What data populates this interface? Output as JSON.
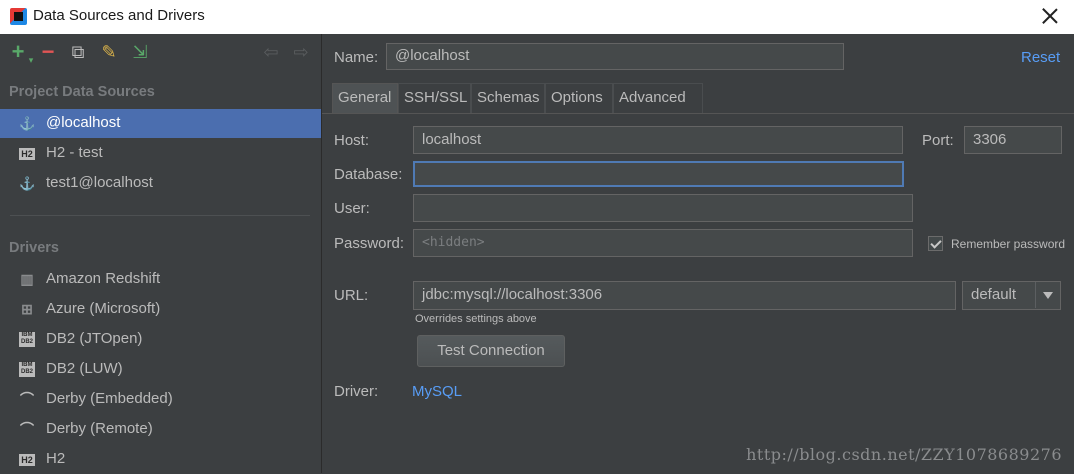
{
  "window": {
    "title": "Data Sources and Drivers"
  },
  "toolbar": {
    "add": "+",
    "remove": "−",
    "copy": "⧉",
    "settings": "✎",
    "import": "⇲",
    "back": "⇦",
    "forward": "⇨"
  },
  "sidebar": {
    "project_heading": "Project Data Sources",
    "data_sources": [
      {
        "label": "@localhost",
        "icon": "dolphin-icon",
        "selected": true
      },
      {
        "label": "H2 - test",
        "icon": "h2-icon",
        "badge": "H2"
      },
      {
        "label": "test1@localhost",
        "icon": "dolphin-icon"
      }
    ],
    "drivers_heading": "Drivers",
    "drivers": [
      {
        "label": "Amazon Redshift",
        "icon": "redshift-icon"
      },
      {
        "label": "Azure (Microsoft)",
        "icon": "windows-icon"
      },
      {
        "label": "DB2 (JTOpen)",
        "icon": "ibm-db2-icon",
        "badge": "IBM DB2"
      },
      {
        "label": "DB2 (LUW)",
        "icon": "ibm-db2-icon",
        "badge": "IBM DB2"
      },
      {
        "label": "Derby (Embedded)",
        "icon": "derby-hat-icon"
      },
      {
        "label": "Derby (Remote)",
        "icon": "derby-hat-icon"
      },
      {
        "label": "H2",
        "icon": "h2-icon",
        "badge": "H2"
      }
    ]
  },
  "main": {
    "name_label": "Name:",
    "name_value": "@localhost",
    "reset_link": "Reset",
    "tabs": [
      "General",
      "SSH/SSL",
      "Schemas",
      "Options",
      "Advanced"
    ],
    "active_tab": "General",
    "host_label": "Host:",
    "host_value": "localhost",
    "port_label": "Port:",
    "port_value": "3306",
    "database_label": "Database:",
    "database_value": "",
    "user_label": "User:",
    "user_value": "",
    "password_label": "Password:",
    "password_placeholder": "<hidden>",
    "remember_password": "Remember password",
    "remember_checked": true,
    "url_label": "URL:",
    "url_value": "jdbc:mysql://localhost:3306",
    "url_mode": "default",
    "url_hint": "Overrides settings above",
    "test_button": "Test Connection",
    "driver_label": "Driver:",
    "driver_link": "MySQL"
  },
  "watermark": "http://blog.csdn.net/ZZY1078689276",
  "colors": {
    "accent": "#4b6eaf",
    "link": "#589df6",
    "background": "#3c3f41"
  }
}
